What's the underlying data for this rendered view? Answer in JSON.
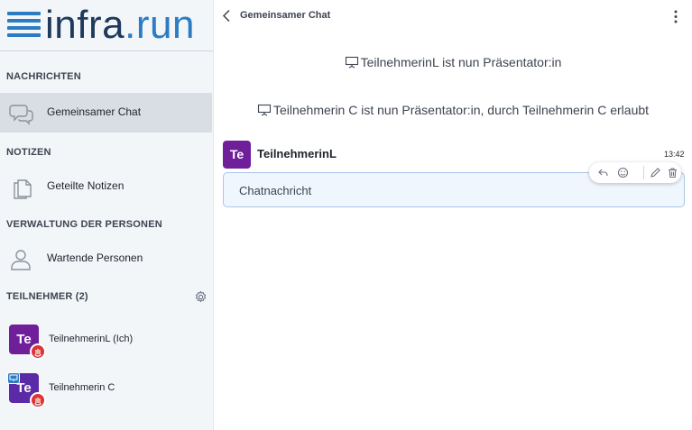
{
  "brand": {
    "name": "infra",
    "dot": ".",
    "tld": "run"
  },
  "sidebar": {
    "messages_title": "NACHRICHTEN",
    "public_chat": "Gemeinsamer Chat",
    "notes_title": "NOTIZEN",
    "shared_notes": "Geteilte Notizen",
    "management_title": "VERWALTUNG DER PERSONEN",
    "waiting_users": "Wartende Personen",
    "participants_title": "TEILNEHMER (2)",
    "participants": [
      {
        "initials": "Te",
        "name": "TeilnehmerinL (Ich)"
      },
      {
        "initials": "Te",
        "name": "Teilnehmerin C"
      }
    ]
  },
  "chat": {
    "title": "Gemeinsamer Chat",
    "system_messages": [
      "TeilnehmerinL ist nun Präsentator:in",
      "Teilnehmerin C ist nun Präsentator:in, durch Teilnehmerin C erlaubt"
    ],
    "message": {
      "avatar_initials": "Te",
      "author": "TeilnehmerinL",
      "time": "13:42",
      "text": "Chatnachricht"
    }
  },
  "colors": {
    "accent": "#2b7cc2",
    "avatar_purple": "#6f1f9a",
    "hand_red": "#d93636",
    "bubble_bg": "#f0f6fd"
  },
  "icons": [
    "chat-bubbles-icon",
    "notes-icon",
    "user-icon",
    "gear-icon",
    "raised-hand-icon",
    "presenter-icon",
    "back-chevron-icon",
    "more-vertical-icon",
    "reply-icon",
    "emoji-icon",
    "edit-icon",
    "trash-icon"
  ]
}
